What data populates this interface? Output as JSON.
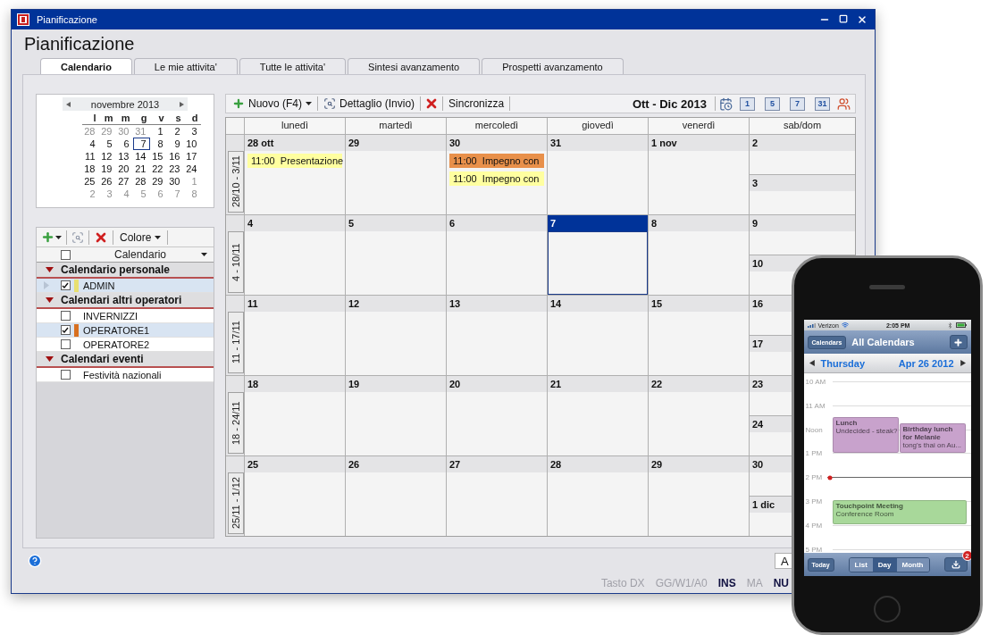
{
  "window": {
    "title": "Pianificazione",
    "heading": "Pianificazione"
  },
  "tabs": [
    {
      "label": "Calendario",
      "selected": true
    },
    {
      "label": "Le mie attivita'",
      "selected": false
    },
    {
      "label": "Tutte le attivita'",
      "selected": false
    },
    {
      "label": "Sintesi avanzamento",
      "selected": false
    },
    {
      "label": "Prospetti avanzamento",
      "selected": false
    }
  ],
  "mini_calendar": {
    "month": "novembre 2013",
    "weekdays": [
      "l",
      "m",
      "m",
      "g",
      "v",
      "s",
      "d"
    ],
    "weeks": [
      [
        {
          "d": "28",
          "muted": true,
          "selected": false
        },
        {
          "d": "29",
          "muted": true,
          "selected": false
        },
        {
          "d": "30",
          "muted": true,
          "selected": false
        },
        {
          "d": "31",
          "muted": true,
          "selected": false
        },
        {
          "d": "1",
          "muted": false,
          "selected": false
        },
        {
          "d": "2",
          "muted": false,
          "selected": false
        },
        {
          "d": "3",
          "muted": false,
          "selected": false
        }
      ],
      [
        {
          "d": "4",
          "muted": false,
          "selected": false
        },
        {
          "d": "5",
          "muted": false,
          "selected": false
        },
        {
          "d": "6",
          "muted": false,
          "selected": false
        },
        {
          "d": "7",
          "muted": false,
          "selected": true
        },
        {
          "d": "8",
          "muted": false,
          "selected": false
        },
        {
          "d": "9",
          "muted": false,
          "selected": false
        },
        {
          "d": "10",
          "muted": false,
          "selected": false
        }
      ],
      [
        {
          "d": "11",
          "muted": false,
          "selected": false
        },
        {
          "d": "12",
          "muted": false,
          "selected": false
        },
        {
          "d": "13",
          "muted": false,
          "selected": false
        },
        {
          "d": "14",
          "muted": false,
          "selected": false
        },
        {
          "d": "15",
          "muted": false,
          "selected": false
        },
        {
          "d": "16",
          "muted": false,
          "selected": false
        },
        {
          "d": "17",
          "muted": false,
          "selected": false
        }
      ],
      [
        {
          "d": "18",
          "muted": false,
          "selected": false
        },
        {
          "d": "19",
          "muted": false,
          "selected": false
        },
        {
          "d": "20",
          "muted": false,
          "selected": false
        },
        {
          "d": "21",
          "muted": false,
          "selected": false
        },
        {
          "d": "22",
          "muted": false,
          "selected": false
        },
        {
          "d": "23",
          "muted": false,
          "selected": false
        },
        {
          "d": "24",
          "muted": false,
          "selected": false
        }
      ],
      [
        {
          "d": "25",
          "muted": false,
          "selected": false
        },
        {
          "d": "26",
          "muted": false,
          "selected": false
        },
        {
          "d": "27",
          "muted": false,
          "selected": false
        },
        {
          "d": "28",
          "muted": false,
          "selected": false
        },
        {
          "d": "29",
          "muted": false,
          "selected": false
        },
        {
          "d": "30",
          "muted": false,
          "selected": false
        },
        {
          "d": "1",
          "muted": true,
          "selected": false
        }
      ],
      [
        {
          "d": "2",
          "muted": true,
          "selected": false
        },
        {
          "d": "3",
          "muted": true,
          "selected": false
        },
        {
          "d": "4",
          "muted": true,
          "selected": false
        },
        {
          "d": "5",
          "muted": true,
          "selected": false
        },
        {
          "d": "6",
          "muted": true,
          "selected": false
        },
        {
          "d": "7",
          "muted": true,
          "selected": false
        },
        {
          "d": "8",
          "muted": true,
          "selected": false
        }
      ]
    ]
  },
  "calendar_list": {
    "color_button": "Colore",
    "column": "Calendario",
    "all_checked": false,
    "groups": [
      {
        "name": "Calendario personale",
        "expanded": true,
        "items": [
          {
            "name": "ADMIN",
            "checked": true,
            "selected": true,
            "current": true,
            "color": "#e8e070"
          }
        ]
      },
      {
        "name": "Calendari altri operatori",
        "expanded": true,
        "items": [
          {
            "name": "INVERNIZZI",
            "checked": false,
            "selected": false,
            "current": false
          },
          {
            "name": "OPERATORE1",
            "checked": true,
            "selected": true,
            "current": false,
            "color": "#d87020"
          },
          {
            "name": "OPERATORE2",
            "checked": false,
            "selected": false,
            "current": false
          }
        ]
      },
      {
        "name": "Calendari eventi",
        "expanded": true,
        "items": [
          {
            "name": "Festività nazionali",
            "checked": false,
            "selected": false,
            "current": false
          }
        ]
      }
    ]
  },
  "toolbar": {
    "new_button": "Nuovo (F4)",
    "detail_button": "Dettaglio (Invio)",
    "sync_button": "Sincronizza",
    "range": "Ott - Dic 2013",
    "view_buttons": [
      "1",
      "5",
      "7",
      "31"
    ]
  },
  "grid": {
    "columns": [
      "lunedì",
      "martedì",
      "mercoledì",
      "giovedì",
      "venerdì",
      "sab/dom"
    ],
    "weeks": [
      {
        "label": "28/10 - 3/11",
        "days": [
          {
            "date": "28 ott",
            "selected": false,
            "events": [
              {
                "time": "11:00",
                "title": "Presentazione",
                "color": "#ffffa0"
              }
            ]
          },
          {
            "date": "29",
            "selected": false
          },
          {
            "date": "30",
            "selected": false,
            "events": [
              {
                "time": "11:00",
                "title": "Impegno con",
                "color": "#e8904a"
              },
              {
                "time": "11:00",
                "title": "Impegno con",
                "color": "#ffffa0"
              }
            ]
          },
          {
            "date": "31",
            "selected": false
          },
          {
            "date": "1 nov",
            "selected": false
          }
        ],
        "weekend": [
          {
            "date": "2",
            "selected": false
          },
          {
            "date": "3",
            "selected": false
          }
        ]
      },
      {
        "label": "4 - 10/11",
        "days": [
          {
            "date": "4",
            "selected": false
          },
          {
            "date": "5",
            "selected": false
          },
          {
            "date": "6",
            "selected": false
          },
          {
            "date": "7",
            "selected": true
          },
          {
            "date": "8",
            "selected": false
          }
        ],
        "weekend": [
          {
            "date": "9",
            "selected": false
          },
          {
            "date": "10",
            "selected": false
          }
        ]
      },
      {
        "label": "11 - 17/11",
        "days": [
          {
            "date": "11",
            "selected": false
          },
          {
            "date": "12",
            "selected": false
          },
          {
            "date": "13",
            "selected": false
          },
          {
            "date": "14",
            "selected": false
          },
          {
            "date": "15",
            "selected": false
          }
        ],
        "weekend": [
          {
            "date": "16",
            "selected": false
          },
          {
            "date": "17",
            "selected": false
          }
        ]
      },
      {
        "label": "18 - 24/11",
        "days": [
          {
            "date": "18",
            "selected": false
          },
          {
            "date": "19",
            "selected": false
          },
          {
            "date": "20",
            "selected": false
          },
          {
            "date": "21",
            "selected": false
          },
          {
            "date": "22",
            "selected": false
          }
        ],
        "weekend": [
          {
            "date": "23",
            "selected": false
          },
          {
            "date": "24",
            "selected": false
          }
        ]
      },
      {
        "label": "25/11 - 1/12",
        "days": [
          {
            "date": "25",
            "selected": false
          },
          {
            "date": "26",
            "selected": false
          },
          {
            "date": "27",
            "selected": false
          },
          {
            "date": "28",
            "selected": false
          },
          {
            "date": "29",
            "selected": false
          }
        ],
        "weekend": [
          {
            "date": "30",
            "selected": false
          },
          {
            "date": "1 dic",
            "selected": false
          }
        ]
      }
    ]
  },
  "footer": {
    "button": "A"
  },
  "status_bar": [
    {
      "text": "Tasto DX",
      "active": false
    },
    {
      "text": "GG/W1/A0",
      "active": false
    },
    {
      "text": "INS",
      "active": true
    },
    {
      "text": "MA",
      "active": false
    },
    {
      "text": "NU",
      "active": true
    }
  ],
  "phone": {
    "carrier": "Verizon",
    "time": "2:05 PM",
    "back_button": "Calendars",
    "title": "All Calendars",
    "day": "Thursday",
    "date": "Apr 26 2012",
    "hours": [
      "10 AM",
      "11 AM",
      "Noon",
      "1 PM",
      "2 PM",
      "3 PM",
      "4 PM",
      "5 PM"
    ],
    "events": [
      {
        "title": "Lunch",
        "subtitle": "Undecided - steak?",
        "color": "#c8a2cc"
      },
      {
        "title": "Birthday lunch for Melanie",
        "subtitle": "tong's thai on Au...",
        "color": "#c8a2cc"
      },
      {
        "title": "Touchpoint Meeting",
        "subtitle": "Conference Room",
        "color": "#a8d89a"
      }
    ],
    "today_button": "Today",
    "modes": [
      {
        "label": "List",
        "selected": false
      },
      {
        "label": "Day",
        "selected": true
      },
      {
        "label": "Month",
        "selected": false
      }
    ],
    "badge": "2"
  }
}
